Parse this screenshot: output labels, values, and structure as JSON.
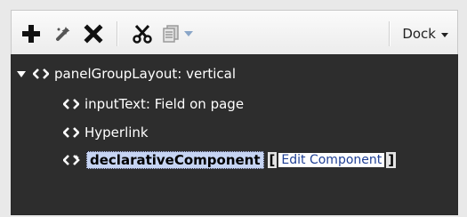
{
  "toolbar": {
    "add_icon": "plus-icon",
    "edit_icon": "wand-icon",
    "delete_icon": "x-icon",
    "cut_icon": "scissors-icon",
    "copy_icon": "copy-icon",
    "dock_label": "Dock"
  },
  "tree": {
    "root": {
      "label": "panelGroupLayout: vertical"
    },
    "children": [
      {
        "label": "inputText: Field on page"
      },
      {
        "label": "Hyperlink"
      },
      {
        "label": "declarativeComponent",
        "open_bracket": "[",
        "link": "Edit Component",
        "close_bracket": "]"
      }
    ]
  },
  "colors": {
    "tree_bg": "#2d2d2d",
    "selection": "#c6d4f2",
    "link": "#1f3f94"
  }
}
